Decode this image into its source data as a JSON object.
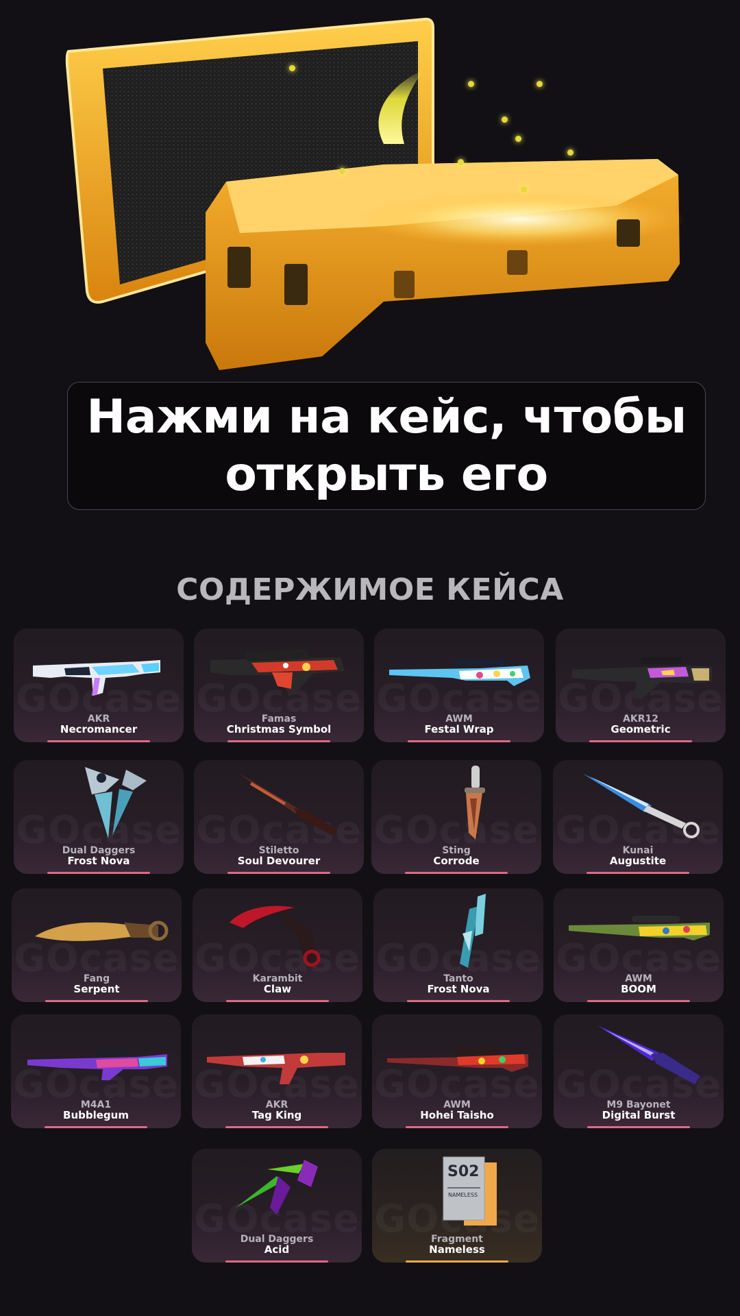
{
  "banner": {
    "line1": "Нажми на кейс, чтобы",
    "line2": "открыть его"
  },
  "contents_title": "СОДЕРЖИМОЕ КЕЙСА",
  "watermark": "GOcase",
  "colors": {
    "background": "#121014",
    "case": "#f2a51c",
    "rarity_pink": "#e06a86",
    "rarity_gold": "#f0a94a",
    "glow": "#e8d83a"
  },
  "items": [
    {
      "weapon": "AKR",
      "skin": "Necromancer",
      "rarity": "pink"
    },
    {
      "weapon": "Famas",
      "skin": "Christmas Symbol",
      "rarity": "pink"
    },
    {
      "weapon": "AWM",
      "skin": "Festal Wrap",
      "rarity": "pink"
    },
    {
      "weapon": "AKR12",
      "skin": "Geometric",
      "rarity": "pink"
    },
    {
      "weapon": "Dual Daggers",
      "skin": "Frost Nova",
      "rarity": "pink"
    },
    {
      "weapon": "Stiletto",
      "skin": "Soul Devourer",
      "rarity": "pink"
    },
    {
      "weapon": "Sting",
      "skin": "Corrode",
      "rarity": "pink"
    },
    {
      "weapon": "Kunai",
      "skin": "Augustite",
      "rarity": "pink"
    },
    {
      "weapon": "Fang",
      "skin": "Serpent",
      "rarity": "pink"
    },
    {
      "weapon": "Karambit",
      "skin": "Claw",
      "rarity": "pink"
    },
    {
      "weapon": "Tanto",
      "skin": "Frost Nova",
      "rarity": "pink"
    },
    {
      "weapon": "AWM",
      "skin": "BOOM",
      "rarity": "pink"
    },
    {
      "weapon": "M4A1",
      "skin": "Bubblegum",
      "rarity": "pink"
    },
    {
      "weapon": "AKR",
      "skin": "Tag King",
      "rarity": "pink"
    },
    {
      "weapon": "AWM",
      "skin": "Hohei Taisho",
      "rarity": "pink"
    },
    {
      "weapon": "M9 Bayonet",
      "skin": "Digital Burst",
      "rarity": "pink"
    },
    {
      "weapon": "Dual Daggers",
      "skin": "Acid",
      "rarity": "pink"
    },
    {
      "weapon": "Fragment",
      "skin": "Nameless",
      "rarity": "gold",
      "fragment_text": {
        "title": "S02",
        "name": "NAMELESS"
      }
    }
  ]
}
